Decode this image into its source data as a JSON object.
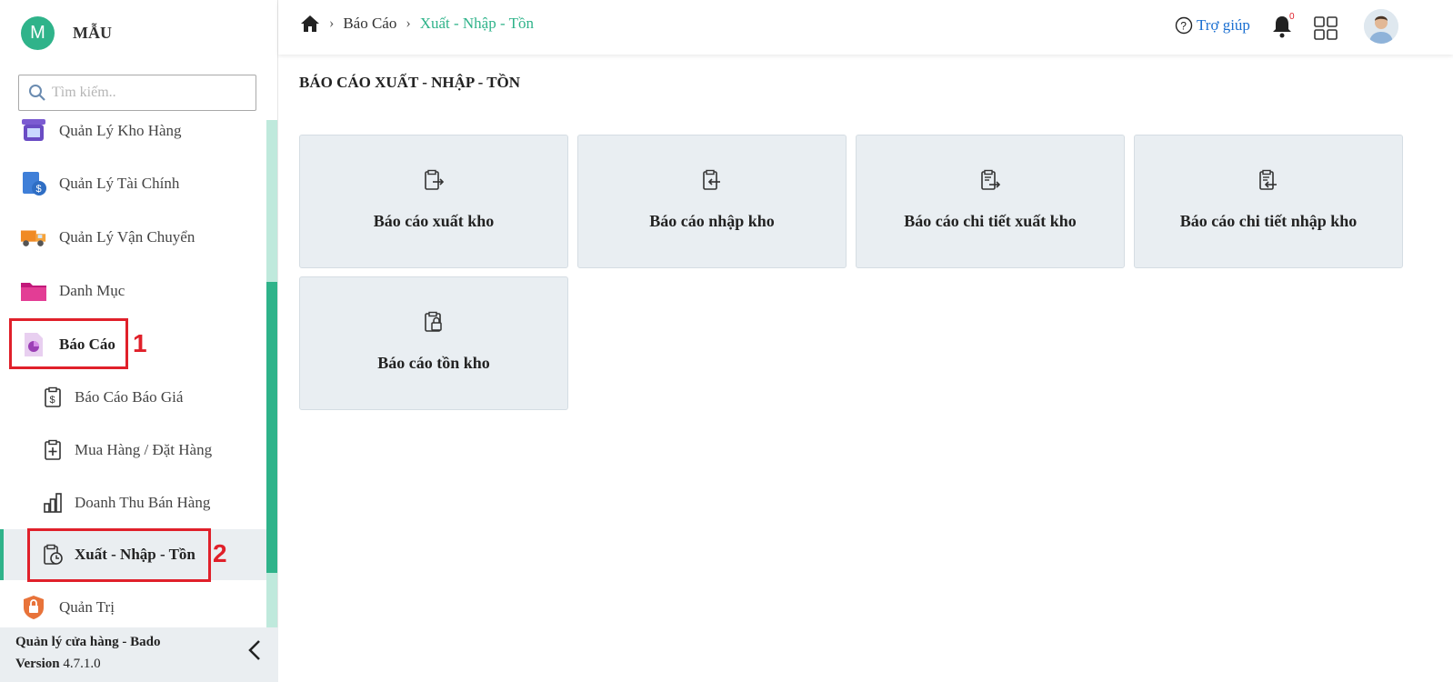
{
  "brand": {
    "initial": "M",
    "name": "MẪU"
  },
  "search": {
    "placeholder": "Tìm kiếm.."
  },
  "sidebar": {
    "items": [
      {
        "label": "Quản Lý Kho Hàng",
        "icon": "warehouse-icon"
      },
      {
        "label": "Quản Lý Tài Chính",
        "icon": "finance-icon"
      },
      {
        "label": "Quản Lý Vận Chuyển",
        "icon": "truck-icon"
      },
      {
        "label": "Danh Mục",
        "icon": "folder-icon"
      },
      {
        "label": "Báo Cáo",
        "icon": "report-icon"
      },
      {
        "label": "Báo Cáo Báo Giá",
        "icon": "clipboard-dollar-icon"
      },
      {
        "label": "Mua Hàng / Đặt Hàng",
        "icon": "clipboard-plus-icon"
      },
      {
        "label": "Doanh Thu Bán Hàng",
        "icon": "bar-chart-icon"
      },
      {
        "label": "Xuất - Nhập - Tồn",
        "icon": "clipboard-clock-icon"
      },
      {
        "label": "Quản Trị",
        "icon": "admin-lock-icon"
      }
    ],
    "annotations": [
      "1",
      "2"
    ],
    "footer": {
      "app": "Quản lý cửa hàng - Bado",
      "version_label": "Version",
      "version": "4.7.1.0"
    }
  },
  "header": {
    "breadcrumb": [
      "Báo Cáo",
      "Xuất - Nhập - Tồn"
    ],
    "help": "Trợ giúp",
    "notification_count": "0"
  },
  "main": {
    "title": "BÁO CÁO XUẤT - NHẬP - TỒN",
    "cards": [
      {
        "label": "Báo cáo xuất kho",
        "icon": "clipboard-export-icon"
      },
      {
        "label": "Báo cáo nhập kho",
        "icon": "clipboard-import-icon"
      },
      {
        "label": "Báo cáo chi tiết xuất kho",
        "icon": "clipboard-list-export-icon"
      },
      {
        "label": "Báo cáo chi tiết nhập kho",
        "icon": "clipboard-list-import-icon"
      },
      {
        "label": "Báo cáo tồn kho",
        "icon": "clipboard-lock-icon"
      }
    ]
  },
  "colors": {
    "accent": "#2fb38a",
    "annotation": "#e0202a",
    "card_bg": "#e9eef2",
    "help_link": "#1a6fd1"
  }
}
